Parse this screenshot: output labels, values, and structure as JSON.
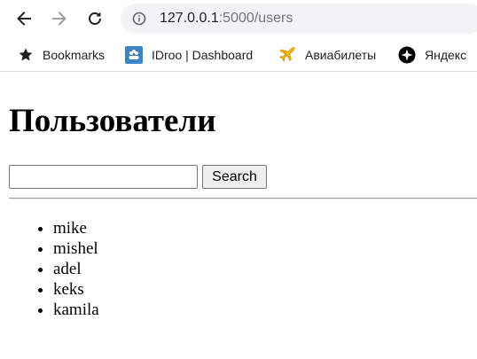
{
  "browser": {
    "url_host": "127.0.0.1",
    "url_path": ":5000/users",
    "icons": {
      "back": "arrow-left-icon",
      "forward": "arrow-right-icon",
      "reload": "reload-icon",
      "site_info": "info-icon"
    }
  },
  "bookmarks": [
    {
      "label": "Bookmarks",
      "icon": "star-icon"
    },
    {
      "label": "IDroo | Dashboard",
      "icon": "idroo-icon"
    },
    {
      "label": "Авиабилеты",
      "icon": "airplane-icon"
    },
    {
      "label": "Яндекс",
      "icon": "yandex-icon"
    }
  ],
  "page": {
    "title": "Пользователи",
    "search": {
      "value": "",
      "button_label": "Search"
    },
    "users": [
      "mike",
      "mishel",
      "adel",
      "keks",
      "kamila"
    ]
  }
}
